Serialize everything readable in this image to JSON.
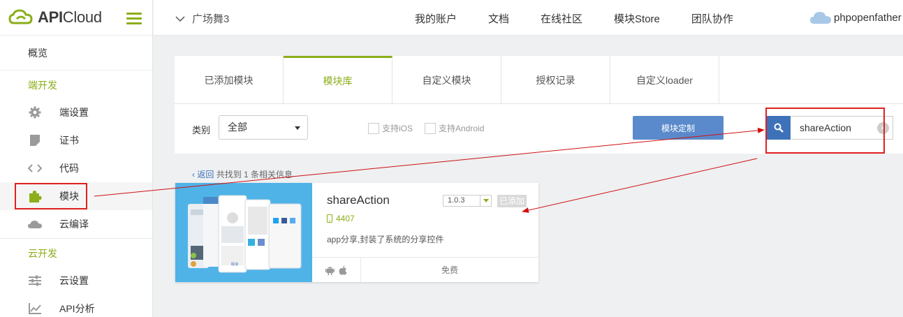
{
  "logo": {
    "brand_api": "API",
    "brand_cloud": "Cloud"
  },
  "sidebar": {
    "overview": "概览",
    "section_client": "端开发",
    "items_client": [
      {
        "label": "端设置",
        "icon": "gear-icon"
      },
      {
        "label": "证书",
        "icon": "certificate-icon"
      },
      {
        "label": "代码",
        "icon": "code-icon"
      },
      {
        "label": "模块",
        "icon": "puzzle-icon"
      },
      {
        "label": "云编译",
        "icon": "cloud-icon"
      }
    ],
    "section_cloud": "云开发",
    "items_cloud": [
      {
        "label": "云设置",
        "icon": "sliders-icon"
      },
      {
        "label": "API分析",
        "icon": "chart-icon"
      }
    ]
  },
  "topbar": {
    "project": "广场舞3",
    "nav": [
      "我的账户",
      "文档",
      "在线社区",
      "模块Store",
      "团队协作"
    ],
    "user": "phpopenfather"
  },
  "tabs": [
    "已添加模块",
    "模块库",
    "自定义模块",
    "授权记录",
    "自定义loader"
  ],
  "active_tab": "模块库",
  "filter": {
    "category_label": "类别",
    "category_value": "全部",
    "ios_label": "支持iOS",
    "android_label": "支持Android",
    "custom_button": "模块定制",
    "search_value": "shareAction"
  },
  "results": {
    "back": "返回",
    "summary": "共找到 1 条相关信息"
  },
  "module": {
    "name": "shareAction",
    "version": "1.0.3",
    "status": "已添加",
    "downloads": "4407",
    "description": "app分享,封装了系统的分享控件",
    "price": "免费"
  },
  "colors": {
    "accent": "#8bae1a",
    "primary": "#3d72b9",
    "highlight": "#e02020"
  }
}
